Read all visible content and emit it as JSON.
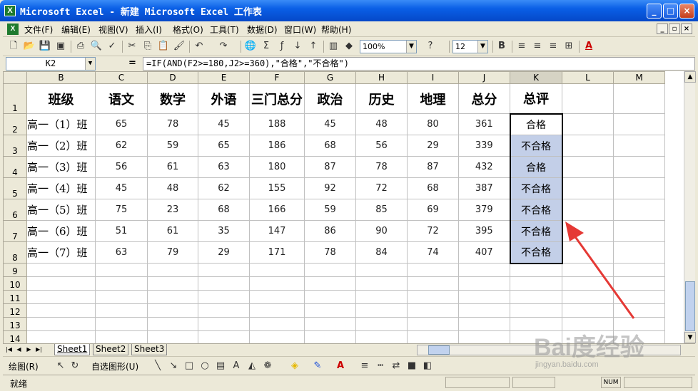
{
  "window": {
    "title": "Microsoft Excel - 新建 Microsoft Excel 工作表",
    "minimize": "_",
    "maximize": "□",
    "close": "×"
  },
  "menu": {
    "items": [
      "文件(F)",
      "编辑(E)",
      "视图(V)",
      "插入(I)",
      "格式(O)",
      "工具(T)",
      "数据(D)",
      "窗口(W)",
      "帮助(H)"
    ],
    "mdi": [
      "_",
      "▫",
      "×"
    ]
  },
  "toolbar": {
    "zoom": "100%",
    "font_size": "12",
    "bold": "B",
    "font_color": "A"
  },
  "formula_bar": {
    "cell_ref": "K2",
    "eq": "=",
    "formula": "=IF(AND(F2>=180,J2>=360),\"合格\",\"不合格\")"
  },
  "sheet": {
    "columns": [
      "B",
      "C",
      "D",
      "E",
      "F",
      "G",
      "H",
      "I",
      "J",
      "K",
      "L",
      "M"
    ],
    "row_numbers": [
      "1",
      "2",
      "3",
      "4",
      "5",
      "6",
      "7",
      "8",
      "9",
      "10",
      "11",
      "12",
      "13",
      "14"
    ],
    "headers": [
      "班级",
      "语文",
      "数学",
      "外语",
      "三门总分",
      "政治",
      "历史",
      "地理",
      "总分",
      "总评"
    ],
    "rows": [
      {
        "class": "高一（1）班",
        "chinese": "65",
        "math": "78",
        "english": "45",
        "total3": "188",
        "politics": "45",
        "history": "48",
        "geography": "80",
        "total": "361",
        "result": "合格"
      },
      {
        "class": "高一（2）班",
        "chinese": "62",
        "math": "59",
        "english": "65",
        "total3": "186",
        "politics": "68",
        "history": "56",
        "geography": "29",
        "total": "339",
        "result": "不合格"
      },
      {
        "class": "高一（3）班",
        "chinese": "56",
        "math": "61",
        "english": "63",
        "total3": "180",
        "politics": "87",
        "history": "78",
        "geography": "87",
        "total": "432",
        "result": "合格"
      },
      {
        "class": "高一（4）班",
        "chinese": "45",
        "math": "48",
        "english": "62",
        "total3": "155",
        "politics": "92",
        "history": "72",
        "geography": "68",
        "total": "387",
        "result": "不合格"
      },
      {
        "class": "高一（5）班",
        "chinese": "75",
        "math": "23",
        "english": "68",
        "total3": "166",
        "politics": "59",
        "history": "85",
        "geography": "69",
        "total": "379",
        "result": "不合格"
      },
      {
        "class": "高一（6）班",
        "chinese": "51",
        "math": "61",
        "english": "35",
        "total3": "147",
        "politics": "86",
        "history": "90",
        "geography": "72",
        "total": "395",
        "result": "不合格"
      },
      {
        "class": "高一（7）班",
        "chinese": "63",
        "math": "79",
        "english": "29",
        "total3": "171",
        "politics": "78",
        "history": "84",
        "geography": "74",
        "total": "407",
        "result": "不合格"
      }
    ]
  },
  "tabs": [
    "Sheet1",
    "Sheet2",
    "Sheet3"
  ],
  "draw_toolbar": {
    "draw": "绘图(R)",
    "autoshapes": "自选图形(U)"
  },
  "status": {
    "text": "就绪",
    "num": "NUM"
  },
  "watermark": {
    "text": "Bai度经验",
    "url": "jingyan.baidu.com"
  },
  "colors": {
    "title_blue": "#0a5fe6",
    "selection": "#c3cfe8",
    "arrow": "#e53935"
  }
}
